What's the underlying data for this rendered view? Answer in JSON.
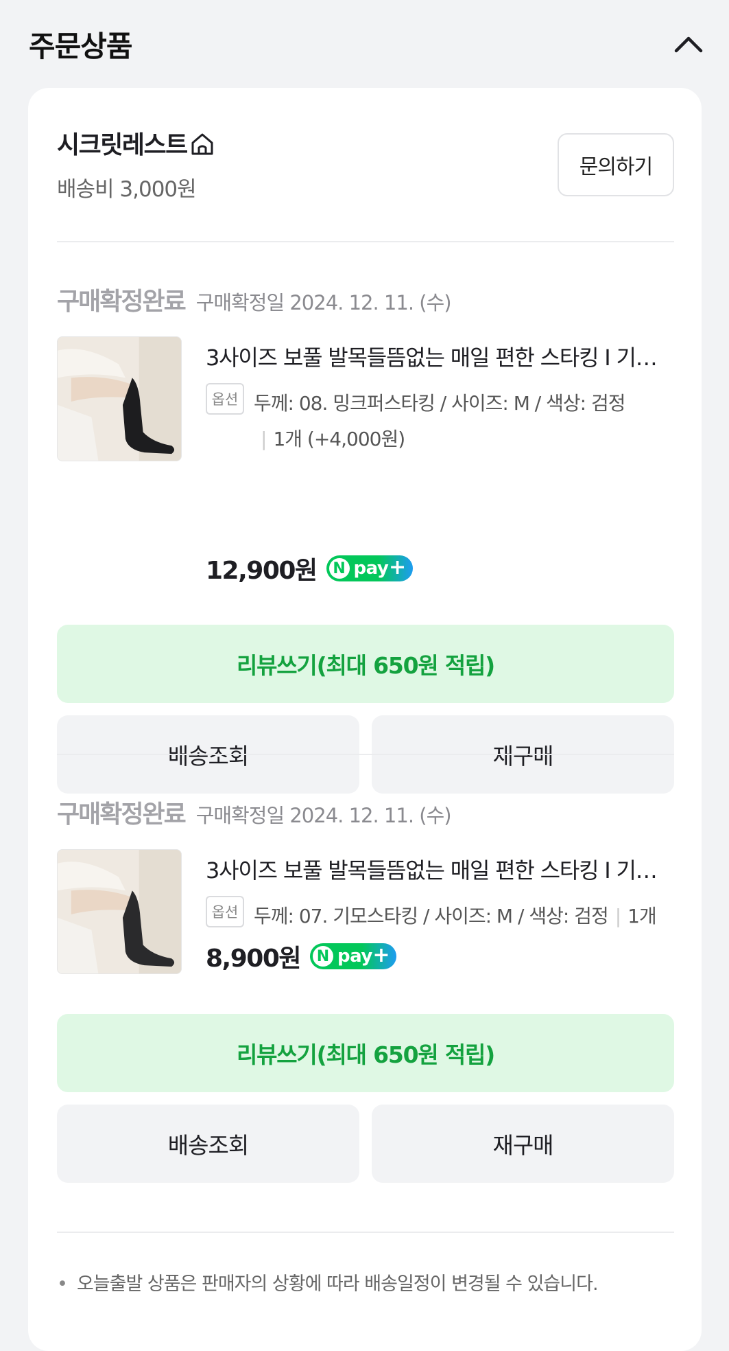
{
  "header": {
    "title": "주문상품"
  },
  "seller": {
    "name": "시크릿레스트",
    "shipping_fee": "배송비 3,000원",
    "inquiry_label": "문의하기"
  },
  "orders": [
    {
      "status": "구매확정완료",
      "confirm_date": "구매확정일 2024. 12. 11. (수)",
      "product_name": "3사이즈 보풀 발목들뜸없는 매일 편한 스타킹 I 기…",
      "option_tag": "옵션",
      "option": "두께: 08. 밍크퍼스타킹 / 사이즈: M / 색상: 검정",
      "quantity": "1개 (+4,000원)",
      "price": "12,900원",
      "review_label": "리뷰쓰기(최대 650원 적립)",
      "track_label": "배송조회",
      "reorder_label": "재구매"
    },
    {
      "status": "구매확정완료",
      "confirm_date": "구매확정일 2024. 12. 11. (수)",
      "product_name": "3사이즈 보풀 발목들뜸없는 매일 편한 스타킹 I 기…",
      "option_tag": "옵션",
      "option": "두께: 07. 기모스타킹 / 사이즈: M / 색상: 검정",
      "quantity": "1개",
      "price": "8,900원",
      "review_label": "리뷰쓰기(최대 650원 적립)",
      "track_label": "배송조회",
      "reorder_label": "재구매"
    }
  ],
  "npay": {
    "n": "N",
    "text": "pay",
    "plus": "+"
  },
  "notice": "오늘출발 상품은 판매자의 상황에 따라 배송일정이 변경될 수 있습니다.",
  "colors": {
    "background": "#f2f3f5",
    "review_bg": "#dff8e4",
    "review_text": "#14a23f",
    "npay_green": "#03c75a",
    "npay_blue": "#1e9cf0"
  },
  "icons": [
    "chevron-up-icon",
    "store-home-icon"
  ]
}
